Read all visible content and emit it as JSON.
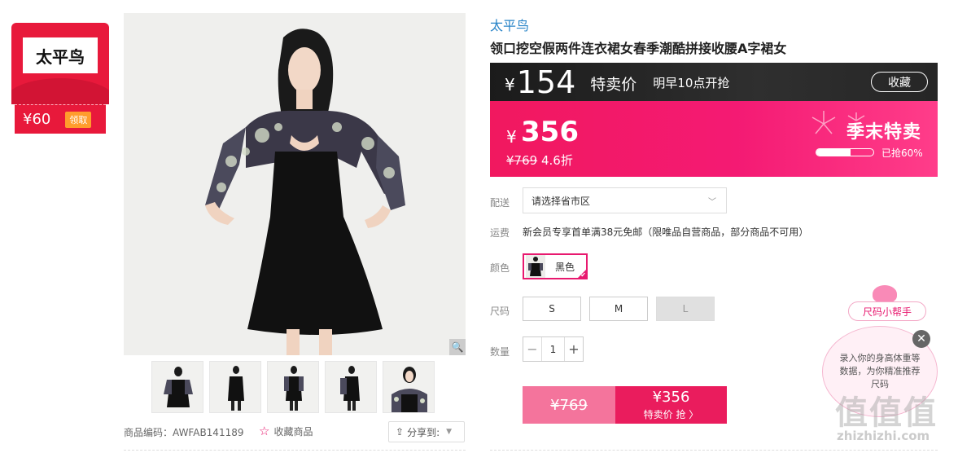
{
  "coupon": {
    "brand": "太平鸟",
    "amount": "¥60",
    "claim": "领取"
  },
  "gallery": {
    "thumbs": [
      "thumb-1",
      "thumb-2",
      "thumb-3",
      "thumb-4",
      "thumb-5"
    ],
    "zoom_icon": "🔍"
  },
  "meta": {
    "sku_label": "商品编码：",
    "sku_value": "AWFAB141189",
    "fav_label": "收藏商品",
    "share_label": "分享到:"
  },
  "product": {
    "brand": "太平鸟",
    "title": "领口挖空假两件连衣裙女春季潮酷拼接收腰A字裙女"
  },
  "flash": {
    "yen": "¥",
    "price": "154",
    "tag": "特卖价",
    "time": "明早10点开抢",
    "fav_button": "收藏"
  },
  "price": {
    "yen": "¥",
    "current": "356",
    "original": "¥769",
    "discount": "4.6折",
    "season": "季末特卖",
    "sold_text": "已抢60%",
    "sold_fraction": 0.6
  },
  "options": {
    "delivery_label": "配送",
    "region_placeholder": "请选择省市区",
    "shipping_label": "运费",
    "shipping_text": "新会员专享首单满38元免邮（限唯品自营商品，部分商品不可用）",
    "color_label": "颜色",
    "color_name": "黑色",
    "size_label": "尺码",
    "sizes": [
      "S",
      "M",
      "L"
    ],
    "qty_label": "数量",
    "qty_minus": "−",
    "qty_value": "1",
    "qty_plus": "+"
  },
  "buy": {
    "left_price": "¥769",
    "right_price": "¥356",
    "right_text": "特卖价 抢 〉"
  },
  "helper": {
    "tag": "尺码小帮手",
    "bubble": "录入你的身高体重等数据，为你精准推荐尺码",
    "close": "✕"
  },
  "watermark": {
    "text": "值值值",
    "url": "zhizhizhi.com"
  }
}
